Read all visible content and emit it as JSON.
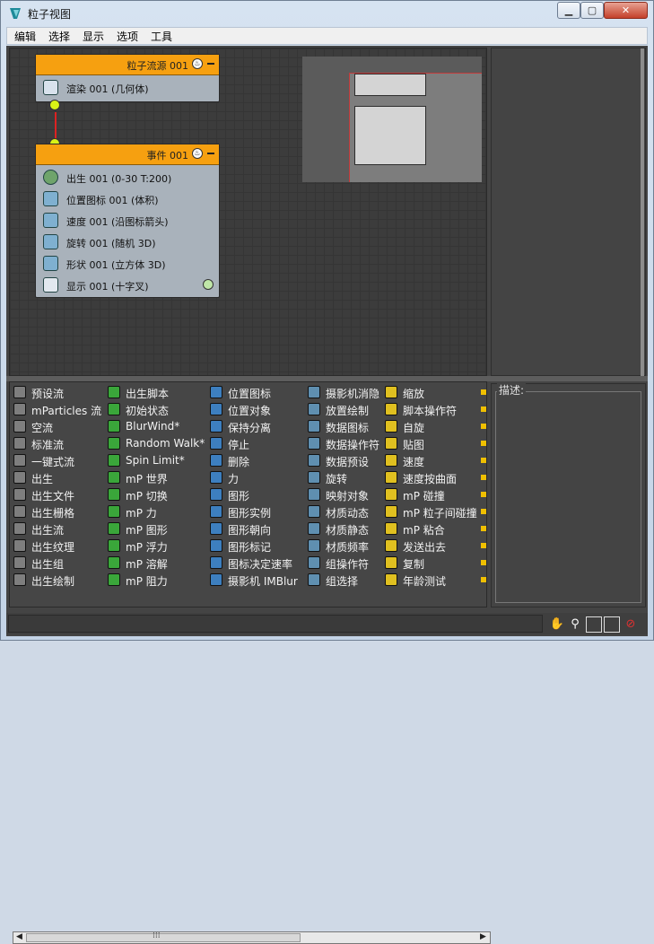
{
  "window": {
    "title": "粒子视图"
  },
  "menu": [
    "编辑",
    "选择",
    "显示",
    "选项",
    "工具"
  ],
  "nodes": {
    "source": {
      "title": "粒子流源 001",
      "operators": [
        {
          "label": "渲染 001 (几何体)",
          "icon": "teapot-icon"
        }
      ]
    },
    "event": {
      "title": "事件 001",
      "operators": [
        {
          "label": "出生 001 (0-30 T:200)",
          "icon": "birth-icon"
        },
        {
          "label": "位置图标 001 (体积)",
          "icon": "position-icon"
        },
        {
          "label": "速度 001 (沿图标箭头)",
          "icon": "speed-icon"
        },
        {
          "label": "旋转 001 (随机 3D)",
          "icon": "rotation-icon"
        },
        {
          "label": "形状 001 (立方体 3D)",
          "icon": "shape-icon"
        },
        {
          "label": "显示 001 (十字叉)",
          "icon": "display-icon"
        }
      ]
    }
  },
  "depot": {
    "columns": [
      [
        "预设流",
        "mParticles 流",
        "空流",
        "标准流",
        "一键式流",
        "出生",
        "出生文件",
        "出生栅格",
        "出生流",
        "出生纹理",
        "出生组",
        "出生绘制"
      ],
      [
        "出生脚本",
        "初始状态",
        "BlurWind*",
        "Random Walk*",
        "Spin Limit*",
        "mP 世界",
        "mP 切换",
        "mP 力",
        "mP 图形",
        "mP 浮力",
        "mP 溶解",
        "mP 阻力"
      ],
      [
        "位置图标",
        "位置对象",
        "保持分离",
        "停止",
        "删除",
        "力",
        "图形",
        "图形实例",
        "图形朝向",
        "图形标记",
        "图标决定速率",
        "摄影机 IMBlur"
      ],
      [
        "摄影机消隐",
        "放置绘制",
        "数据图标",
        "数据操作符",
        "数据预设",
        "旋转",
        "映射对象",
        "材质动态",
        "材质静态",
        "材质频率",
        "组操作符",
        "组选择"
      ],
      [
        "缩放",
        "脚本操作符",
        "自旋",
        "贴图",
        "速度",
        "速度按曲面",
        "mP 碰撞",
        "mP 粒子间碰撞",
        "mP 粘合",
        "发送出去",
        "复制",
        "年龄测试"
      ]
    ],
    "icon_colors": [
      "#7e7e7e",
      "#3aa63a",
      "#3d7fbf",
      "#5f8fb0",
      "#e0c020"
    ]
  },
  "description": {
    "label": "描述:"
  },
  "scrollbar": {
    "grip": "⁞⁞⁞"
  },
  "toolbar": [
    "pan-icon",
    "zoom-icon",
    "zoom-region-icon",
    "zoom-extents-icon",
    "no-zoom-icon"
  ]
}
